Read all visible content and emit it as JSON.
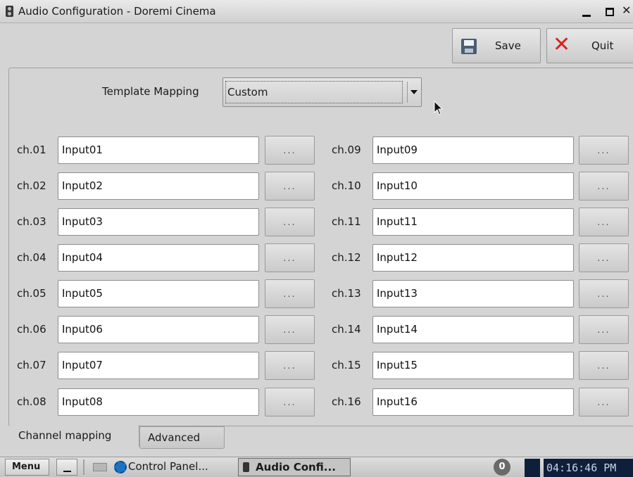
{
  "window": {
    "title": "Audio Configuration - Doremi Cinema",
    "icon": "speaker-icon",
    "controls": {
      "minimize": "minimize-icon",
      "maximize": "maximize-icon",
      "close": "✕"
    }
  },
  "toolbar": {
    "save_label": "Save",
    "save_icon": "floppy-icon",
    "quit_label": "Quit",
    "quit_icon": "x-icon",
    "quit_icon_color": "#d9221c"
  },
  "template": {
    "label": "Template Mapping",
    "selected": "Custom"
  },
  "channels": [
    {
      "label": "ch.01",
      "value": "Input01"
    },
    {
      "label": "ch.02",
      "value": "Input02"
    },
    {
      "label": "ch.03",
      "value": "Input03"
    },
    {
      "label": "ch.04",
      "value": "Input04"
    },
    {
      "label": "ch.05",
      "value": "Input05"
    },
    {
      "label": "ch.06",
      "value": "Input06"
    },
    {
      "label": "ch.07",
      "value": "Input07"
    },
    {
      "label": "ch.08",
      "value": "Input08"
    },
    {
      "label": "ch.09",
      "value": "Input09"
    },
    {
      "label": "ch.10",
      "value": "Input10"
    },
    {
      "label": "ch.11",
      "value": "Input11"
    },
    {
      "label": "ch.12",
      "value": "Input12"
    },
    {
      "label": "ch.13",
      "value": "Input13"
    },
    {
      "label": "ch.14",
      "value": "Input14"
    },
    {
      "label": "ch.15",
      "value": "Input15"
    },
    {
      "label": "ch.16",
      "value": "Input16"
    }
  ],
  "browse_label": "...",
  "tabs": [
    {
      "label": "Channel mapping",
      "active": true
    },
    {
      "label": "Advanced",
      "active": false
    }
  ],
  "taskbar": {
    "menu_label": "Menu",
    "control_panel": "Control Panel...",
    "audio_config": "Audio Confi...",
    "badge": "0",
    "clock": "04:16:46 PM",
    "clock_bg": "#0e1f3c"
  }
}
